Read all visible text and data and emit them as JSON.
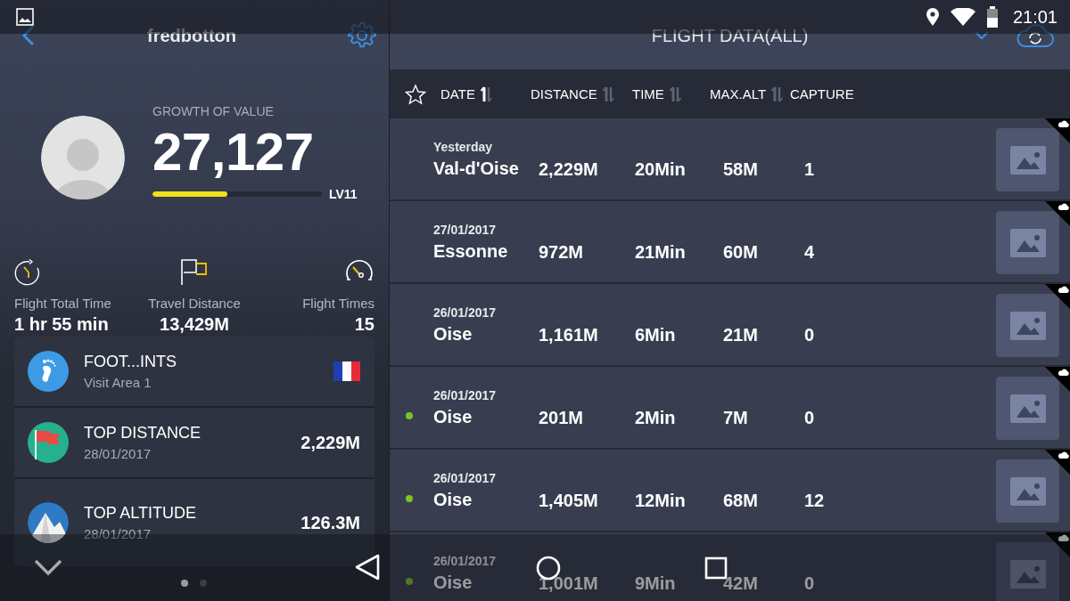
{
  "status_bar": {
    "time": "21:01"
  },
  "profile": {
    "username": "fredbotton",
    "growth_label": "GROWTH OF VALUE",
    "growth_value": "27,127",
    "level": 0.44,
    "level_label": "LV11",
    "stats": [
      {
        "kind": "time",
        "label": "Flight Total Time",
        "value": "1 hr 55 min"
      },
      {
        "kind": "distance",
        "label": "Travel Distance",
        "value": "13,429M"
      },
      {
        "kind": "times",
        "label": "Flight Times",
        "value": "15"
      }
    ],
    "cards": [
      {
        "kind": "footprints",
        "title": "FOOT...INTS",
        "subtitle": "Visit Area 1"
      },
      {
        "kind": "distance",
        "title": "TOP DISTANCE",
        "subtitle": "28/01/2017",
        "value": "2,229M"
      },
      {
        "kind": "altitude",
        "title": "TOP ALTITUDE",
        "subtitle": "28/01/2017",
        "value": "126.3M"
      }
    ],
    "page_dots": [
      {
        "selected": true
      },
      {
        "selected": false
      }
    ]
  },
  "flight_data": {
    "title": "FLIGHT DATA(ALL)",
    "columns": [
      {
        "label": "DATE",
        "sortable": true,
        "sort_active": true
      },
      {
        "label": "DISTANCE",
        "sortable": true,
        "sort_active": false
      },
      {
        "label": "TIME",
        "sortable": true,
        "sort_active": false
      },
      {
        "label": "MAX.ALT",
        "sortable": true,
        "sort_active": false
      },
      {
        "label": "CAPTURE",
        "sortable": false,
        "sort_active": false
      }
    ],
    "rows": [
      {
        "date": "Yesterday",
        "place": "Val-d'Oise",
        "distance": "2,229M",
        "time": "20Min",
        "max_alt": "58M",
        "capture": "1",
        "marked": false
      },
      {
        "date": "27/01/2017",
        "place": "Essonne",
        "distance": "972M",
        "time": "21Min",
        "max_alt": "60M",
        "capture": "4",
        "marked": false
      },
      {
        "date": "26/01/2017",
        "place": "Oise",
        "distance": "1,161M",
        "time": "6Min",
        "max_alt": "21M",
        "capture": "0",
        "marked": false
      },
      {
        "date": "26/01/2017",
        "place": "Oise",
        "distance": "201M",
        "time": "2Min",
        "max_alt": "7M",
        "capture": "0",
        "marked": true
      },
      {
        "date": "26/01/2017",
        "place": "Oise",
        "distance": "1,405M",
        "time": "12Min",
        "max_alt": "68M",
        "capture": "12",
        "marked": true
      },
      {
        "date": "26/01/2017",
        "place": "Oise",
        "distance": "1,001M",
        "time": "9Min",
        "max_alt": "42M",
        "capture": "0",
        "marked": true
      }
    ]
  }
}
